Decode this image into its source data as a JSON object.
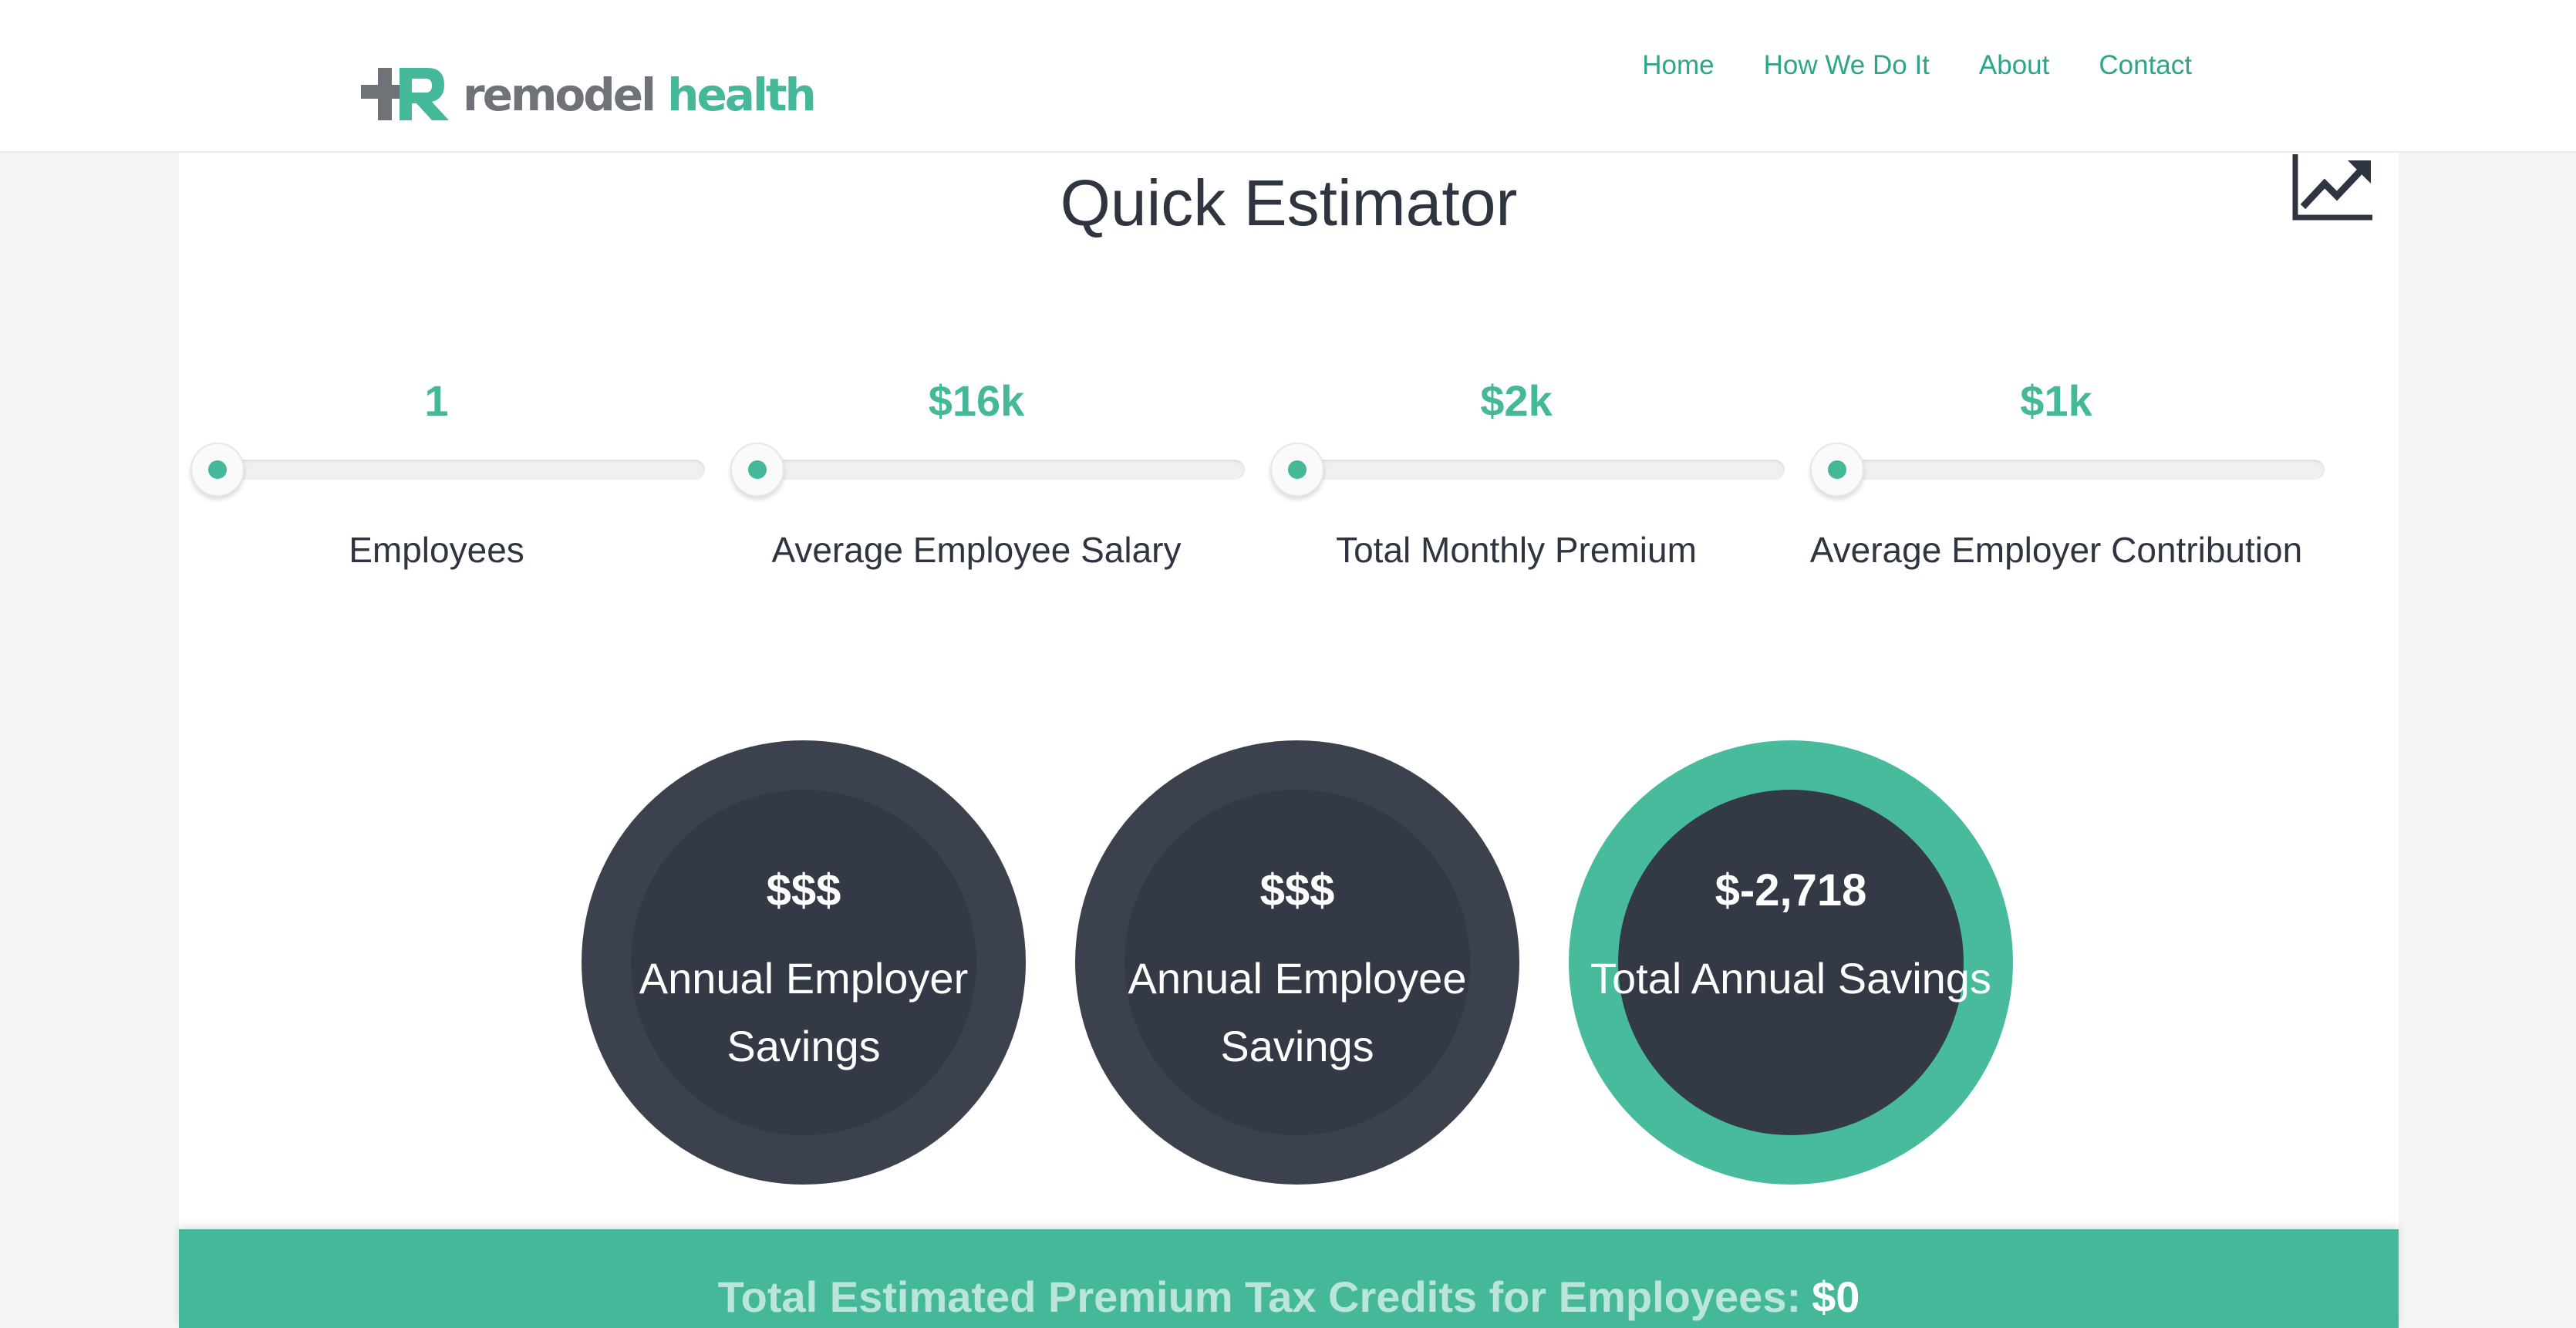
{
  "header": {
    "logo": {
      "word1": "remodel",
      "word2": "health",
      "icon": "plus-r-logo-icon"
    },
    "nav": [
      {
        "label": "Home"
      },
      {
        "label": "How We Do It"
      },
      {
        "label": "About"
      },
      {
        "label": "Contact"
      }
    ]
  },
  "main": {
    "title": "Quick Estimator",
    "chart_icon": "trending-up-chart-icon",
    "sliders": [
      {
        "value": "1",
        "label": "Employees",
        "fill_fraction": 0
      },
      {
        "value": "$16k",
        "label": "Average Employee Salary",
        "fill_fraction": 0
      },
      {
        "value": "$2k",
        "label": "Total Monthly Premium",
        "fill_fraction": 0
      },
      {
        "value": "$1k",
        "label": "Average Employer Contribution",
        "fill_fraction": 0
      }
    ],
    "savings": [
      {
        "amount": "$$$",
        "caption": "Annual Employer Savings",
        "style": "dark"
      },
      {
        "amount": "$$$",
        "caption": "Annual Employee Savings",
        "style": "dark"
      },
      {
        "amount": "$-2,718",
        "caption": "Total Annual Savings",
        "style": "green"
      }
    ],
    "footer": {
      "label": "Total Estimated Premium Tax Credits for Employees:",
      "value": "$0"
    }
  },
  "colors": {
    "accent": "#45b89a",
    "accent_light": "#b9e6d8",
    "dark_circle": "#3c424d",
    "dark_inner": "#333945",
    "logo_gray": "#6f7377",
    "text": "#2f3540"
  }
}
